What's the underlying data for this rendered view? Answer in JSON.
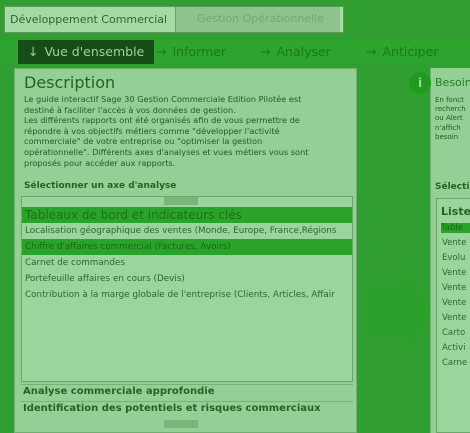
{
  "tabs": {
    "active": "Développement Commercial",
    "inactive": "Gestion Opérationnelle"
  },
  "navbar": {
    "items": [
      "Vue d'ensemble",
      "Informer",
      "Analyser",
      "Anticiper"
    ],
    "active_index": 0
  },
  "description": {
    "title": "Description",
    "text": "Le guide interactif Sage 30 Gestion Commerciale Edition Pilotée est\ndestiné à faciliter l'accès à vos données de gestion.\nLes différents rapports ont été organisés afin de vous permettre de\nrépondre à vos objectifs métiers comme \"développer l'activité\ncommerciale\" de votre entreprise ou \"optimiser la gestion\nopérationnelle\". Différents axes d'analyses et vues métiers vous sont\nproposés pour accéder aux rapports."
  },
  "axe": {
    "label": "Sélectionner un axe d'analyse",
    "list": [
      "Tableaux de bord et indicateurs clés",
      "Localisation géographique des ventes (Monde, Europe, France,Régions",
      "Chiffre d'affaires commercial (Factures, Avoirs)",
      "Carnet de commandes",
      "Portefeuille affaires en cours (Devis)",
      "Contribution à la marge globale de l'entreprise (Clients, Articles, Affair"
    ],
    "analyse_1": "Analyse commerciale approfondie",
    "analyse_2": "Identification des potentiels et risques commerciaux"
  },
  "right_panel": {
    "besoin_title": "Besoin",
    "text_lines": [
      "En fonct",
      "recherch",
      "ou Alert",
      "n'affich",
      "besoin"
    ],
    "section_label": "Sélection",
    "box_title": "Liste",
    "items": [
      "Table",
      "Vente",
      "Evolu",
      "Vente",
      "Vente",
      "Vente",
      "Vente",
      "Carto",
      "Activi",
      "Carne"
    ],
    "highlight_index": 0
  },
  "colors": {
    "overlay_green": "#26aa26",
    "nav_active_bg": "#0b0b0b"
  }
}
